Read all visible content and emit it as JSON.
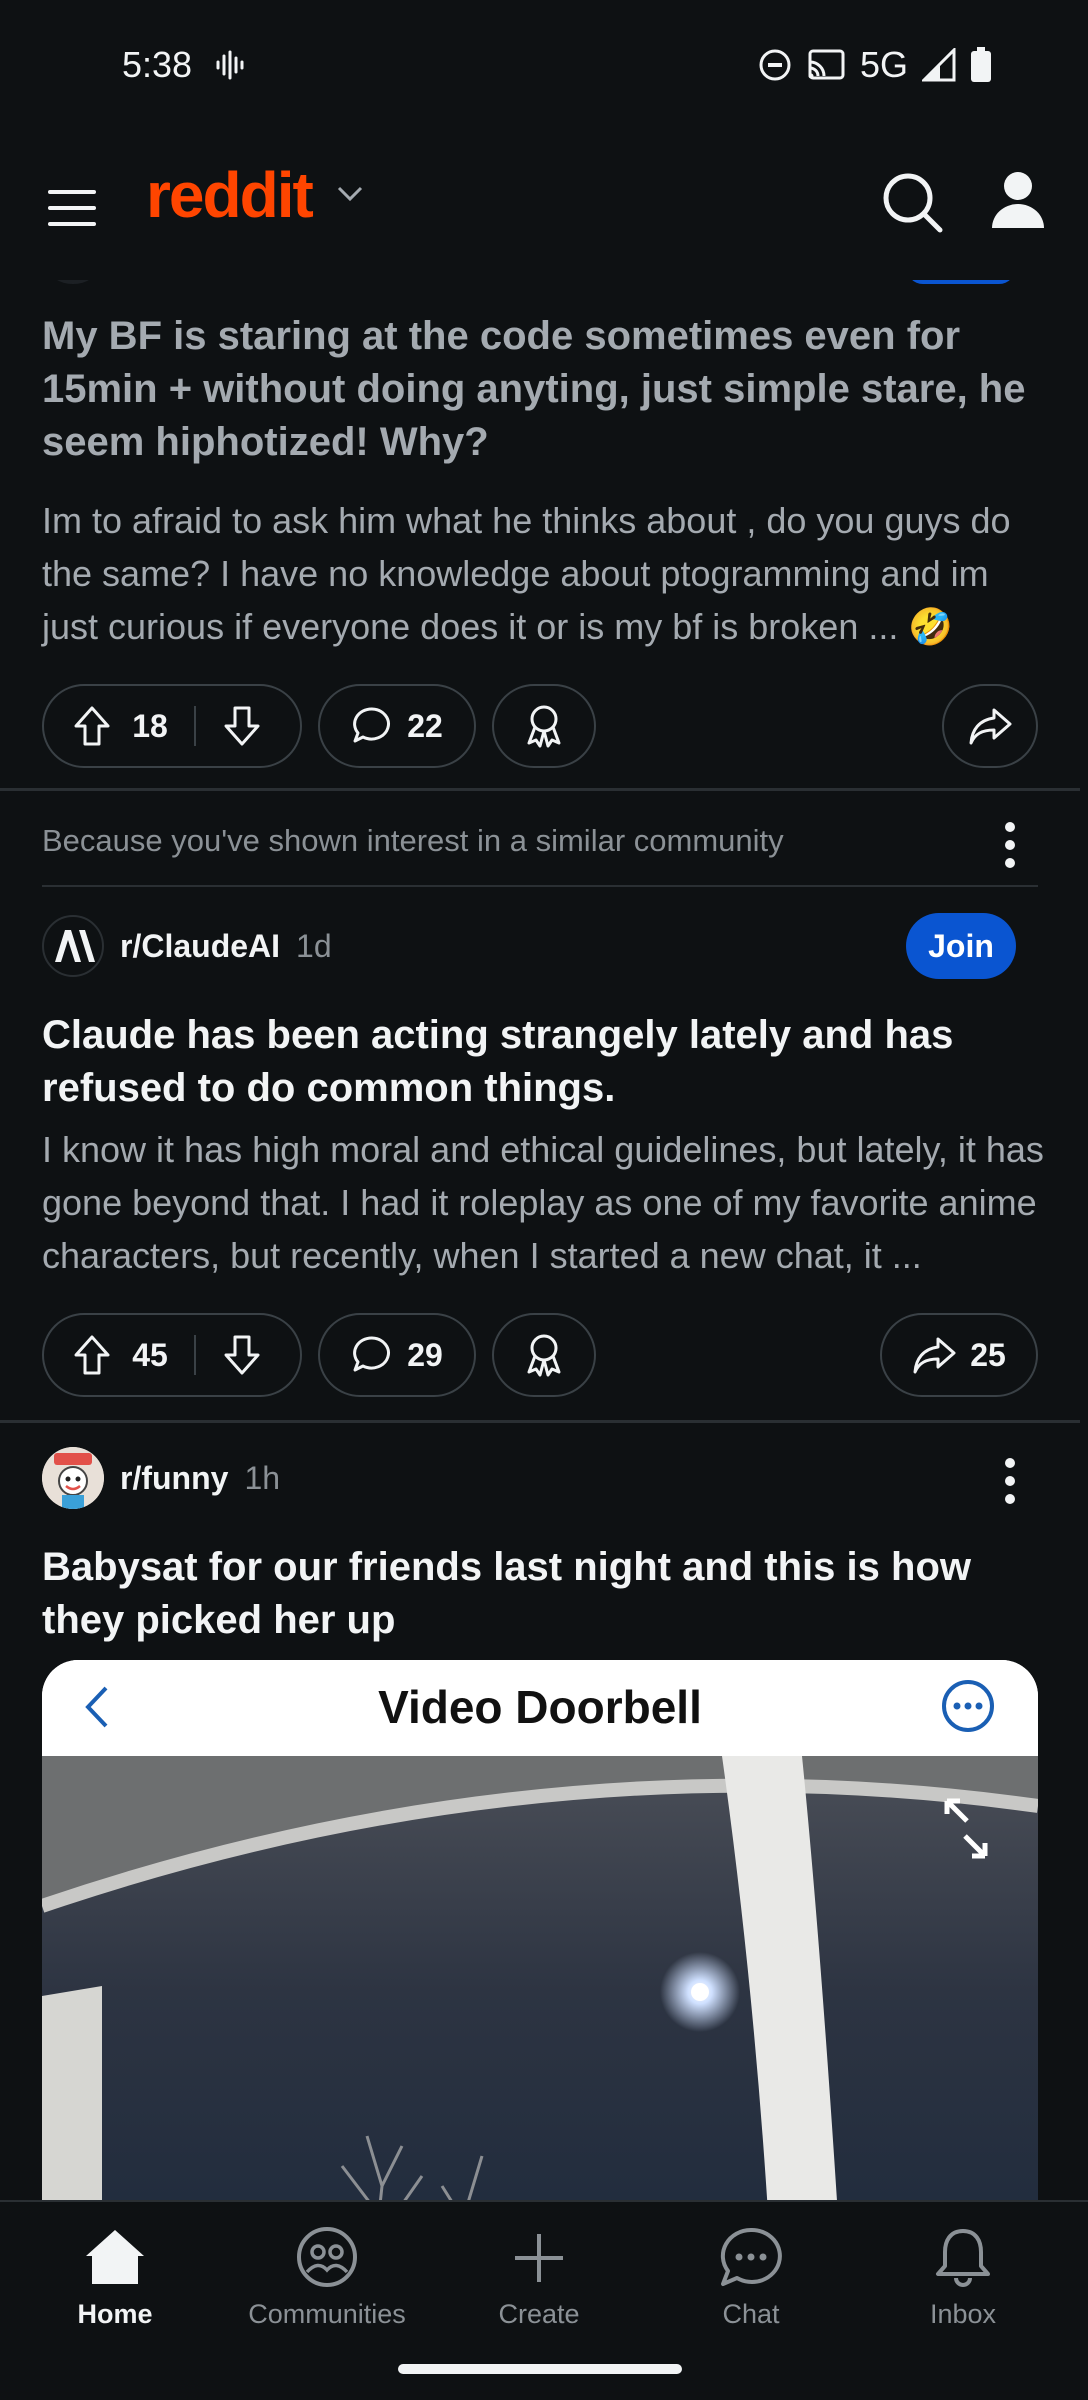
{
  "status": {
    "time": "5:38",
    "network": "5G"
  },
  "header": {
    "logo": "reddit"
  },
  "posts": [
    {
      "title": "My BF is staring at the code sometimes even for 15min + without doing anyting, just simple stare, he seem hiphotized! Why?",
      "body": "Im to afraid to ask him what he thinks about , do you guys do the same? I have no knowledge about ptogramming and im just curious if everyone does it or is my bf is broken ... 🤣",
      "upvotes": "18",
      "comments": "22"
    },
    {
      "context": "Because you've shown interest in a similar community",
      "subreddit": "r/ClaudeAI",
      "age": "1d",
      "join_label": "Join",
      "title": "Claude has been acting strangely lately and has refused to do common things.",
      "body": "I know it has high moral and ethical guidelines, but lately, it has gone beyond that. I had it roleplay as one of my favorite anime characters, but recently, when I started a new chat, it ...",
      "upvotes": "45",
      "comments": "29",
      "shares": "25"
    },
    {
      "subreddit": "r/funny",
      "age": "1h",
      "title": "Babysat for our friends last night and this is how they picked her up",
      "image_header": "Video Doorbell"
    }
  ],
  "nav": [
    {
      "label": "Home",
      "icon": "home-icon",
      "active": true
    },
    {
      "label": "Communities",
      "icon": "communities-icon"
    },
    {
      "label": "Create",
      "icon": "plus-icon"
    },
    {
      "label": "Chat",
      "icon": "chat-icon"
    },
    {
      "label": "Inbox",
      "icon": "bell-icon"
    }
  ],
  "colors": {
    "brand": "#ff4500",
    "join": "#0a55d1",
    "background": "#0e1113"
  }
}
